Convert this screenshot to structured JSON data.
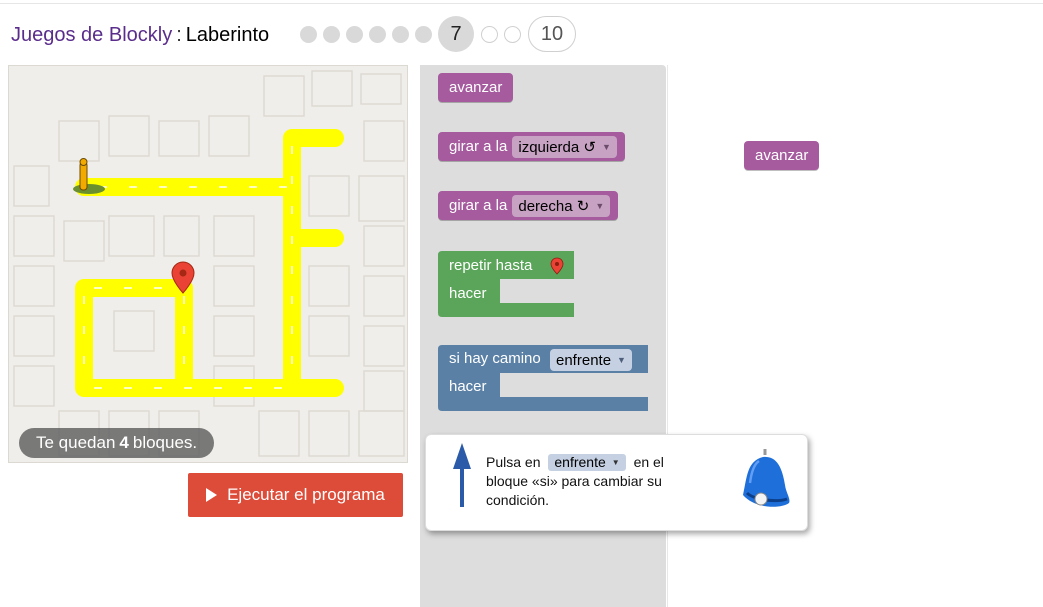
{
  "header": {
    "app_title": "Juegos de Blockly",
    "separator": ":",
    "game_title": "Laberinto",
    "current_level": "7",
    "last_level": "10",
    "levels_done_count": 6,
    "levels_future_count": 2
  },
  "maze": {
    "blocks_left_prefix": "Te quedan",
    "blocks_left_count": "4",
    "blocks_left_suffix": "bloques."
  },
  "run_button": {
    "label": "Ejecutar el programa"
  },
  "toolbox": {
    "avanzar": "avanzar",
    "turn_left_prefix": "girar a la",
    "turn_left_option": "izquierda ↺",
    "turn_right_prefix": "girar a la",
    "turn_right_option": "derecha ↻",
    "repeat_label": "repetir hasta",
    "repeat_do": "hacer",
    "if_label": "si hay camino",
    "if_option": "enfrente",
    "if_do": "hacer"
  },
  "workspace": {
    "block_label": "avanzar"
  },
  "hint": {
    "text_before": "Pulsa en",
    "dropdown": "enfrente",
    "text_after": "en el bloque «si» para cambiar su condición."
  },
  "colors": {
    "move_block": "#a55b9e",
    "loop_block": "#5ba55b",
    "logic_block": "#5b80a5",
    "path": "#ffff00",
    "run_button": "#dd4b39"
  }
}
